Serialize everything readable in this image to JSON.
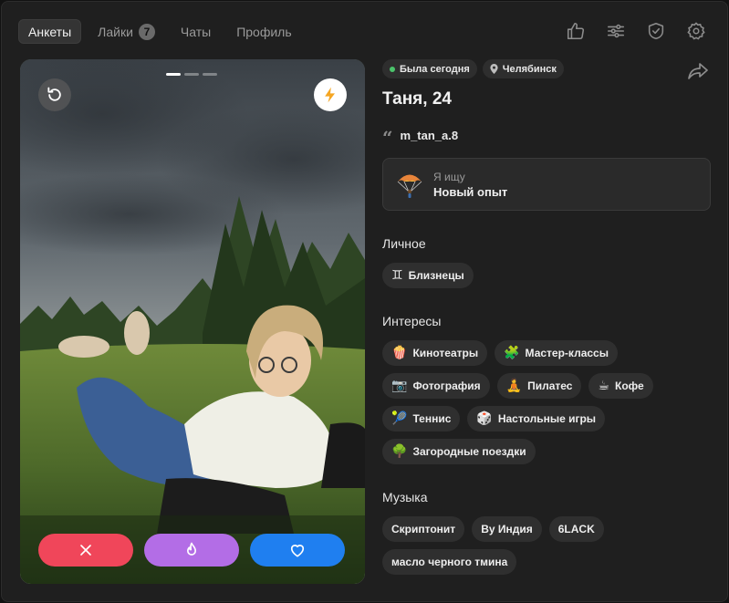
{
  "nav": {
    "tabs": [
      {
        "label": "Анкеты",
        "active": true
      },
      {
        "label": "Лайки",
        "badge": "7"
      },
      {
        "label": "Чаты"
      },
      {
        "label": "Профиль"
      }
    ],
    "icons": [
      "thumbs-up-icon",
      "filters-icon",
      "shield-check-icon",
      "settings-icon"
    ]
  },
  "photo": {
    "pages_total": 3,
    "current_page": 1,
    "actions": [
      "dislike",
      "super-like",
      "like"
    ]
  },
  "profile": {
    "status": "Была сегодня",
    "city": "Челябинск",
    "name_age": "Таня, 24",
    "instagram": "m_tan_a.8",
    "looking_label": "Я ищу",
    "looking_value": "Новый опыт",
    "personal_title": "Личное",
    "personal": [
      {
        "icon": "♊",
        "label": "Близнецы"
      }
    ],
    "interests_title": "Интересы",
    "interests": [
      {
        "icon": "🍿",
        "label": "Кинотеатры"
      },
      {
        "icon": "🧩",
        "label": "Мастер-классы"
      },
      {
        "icon": "📷",
        "label": "Фотография"
      },
      {
        "icon": "🧘",
        "label": "Пилатес"
      },
      {
        "icon": "☕",
        "label": "Кофе"
      },
      {
        "icon": "🎾",
        "label": "Теннис"
      },
      {
        "icon": "🎲",
        "label": "Настольные игры"
      },
      {
        "icon": "🌳",
        "label": "Загородные поездки"
      }
    ],
    "music_title": "Музыка",
    "music": [
      "Скриптонит",
      "By Индия",
      "6LACK",
      "масло черного тмина"
    ]
  },
  "colors": {
    "dislike": "#f0465a",
    "super": "#b36de6",
    "like": "#1f7ff0",
    "online": "#4bc46b"
  }
}
